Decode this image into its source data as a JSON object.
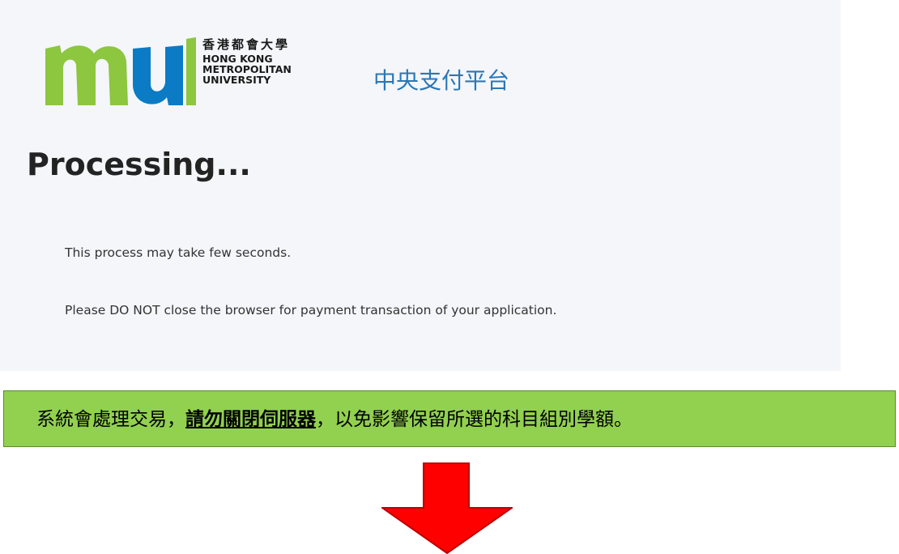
{
  "logo": {
    "name_zh": "香港都會大學",
    "name_en_lines": [
      "HONG KONG",
      "METROPOLITAN",
      "UNIVERSITY"
    ],
    "colors": {
      "green": "#8dc63f",
      "blue": "#0a7bc4"
    }
  },
  "platform_title": "中央支付平台",
  "page": {
    "heading": "Processing...",
    "message1": "This process may take few seconds.",
    "message2": "Please DO NOT close the browser for payment transaction of your application."
  },
  "notice": {
    "part1": "系統會處理交易，",
    "emphasis": "請勿關閉伺服器",
    "part2": "，以免影響保留所選的科目組別學額。",
    "background": "#92d050"
  },
  "arrow": {
    "icon": "arrow-down-icon",
    "color": "#ff0000"
  }
}
